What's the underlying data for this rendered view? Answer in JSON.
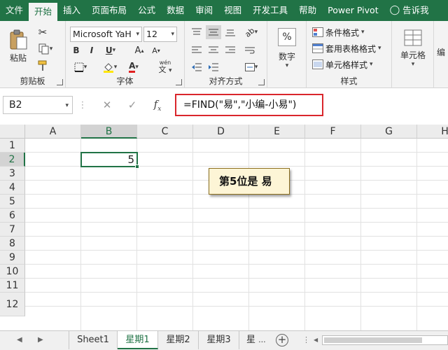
{
  "tabs": [
    "文件",
    "开始",
    "插入",
    "页面布局",
    "公式",
    "数据",
    "审阅",
    "视图",
    "开发工具",
    "帮助",
    "Power Pivot",
    "告诉我"
  ],
  "active_tab_index": 1,
  "clipboard": {
    "paste_label": "粘贴",
    "group_label": "剪贴板"
  },
  "font": {
    "name": "Microsoft YaH",
    "size": "12",
    "group_label": "字体",
    "wen_label": "wén",
    "bold": "B",
    "italic": "I",
    "underline": "U",
    "grow": "A",
    "shrink": "A",
    "font_color": "A"
  },
  "alignment": {
    "group_label": "对齐方式"
  },
  "number": {
    "label": "数字",
    "symbol": "%"
  },
  "styles": {
    "conditional": "条件格式",
    "table_format": "套用表格格式",
    "cell_styles": "单元格样式",
    "group_label": "样式"
  },
  "cells": {
    "label": "单元格",
    "edit_label": "编"
  },
  "formula_bar": {
    "name_box": "B2",
    "formula": "=FIND(\"易\",\"小编-小易\")"
  },
  "columns": [
    "A",
    "B",
    "C",
    "D",
    "E",
    "F",
    "G",
    "H"
  ],
  "rows": [
    "1",
    "2",
    "3",
    "4",
    "5",
    "6",
    "7",
    "8",
    "9",
    "10",
    "11",
    "12"
  ],
  "selected_cell": {
    "ref": "B2",
    "value": "5"
  },
  "callout": {
    "text": "第5位是 易"
  },
  "sheets": [
    "Sheet1",
    "星期1",
    "星期2",
    "星期3",
    "星"
  ],
  "active_sheet_index": 1,
  "colors": {
    "accent": "#217346",
    "highlight_border": "#d9262c",
    "note_bg": "#fdf5d6",
    "font_color_bar": "#e02020",
    "fill_color_bar": "#ffe600"
  }
}
